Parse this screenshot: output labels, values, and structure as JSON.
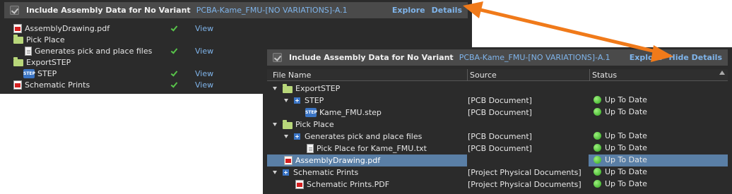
{
  "panel1": {
    "title": "Include Assembly Data for No Variant",
    "subtitle": "PCBA-Kame_FMU-[NO VARIATIONS]-A.1",
    "explore": "Explore",
    "details": "Details",
    "rows": [
      {
        "name": "AssemblyDrawing.pdf",
        "view": "View"
      },
      {
        "name": "Pick Place"
      },
      {
        "name": "Generates pick and place files",
        "view": "View"
      },
      {
        "name": "ExportSTEP"
      },
      {
        "name": "STEP",
        "view": "View"
      },
      {
        "name": "Schematic Prints",
        "view": "View"
      }
    ]
  },
  "panel2": {
    "title": "Include Assembly Data for No Variant",
    "subtitle": "PCBA-Kame_FMU-[NO VARIATIONS]-A.1",
    "explore": "Explore",
    "hide_details": "Hide Details",
    "columns": {
      "file": "File Name",
      "source": "Source",
      "status": "Status"
    },
    "rows": [
      {
        "name": "ExportSTEP",
        "source": "",
        "status": ""
      },
      {
        "name": "STEP",
        "source": "[PCB Document]",
        "status": "Up To Date"
      },
      {
        "name": "Kame_FMU.step",
        "source": "[PCB Document]",
        "status": "Up To Date"
      },
      {
        "name": "Pick Place",
        "source": "",
        "status": ""
      },
      {
        "name": "Generates pick and place files",
        "source": "[PCB Document]",
        "status": "Up To Date"
      },
      {
        "name": "Pick Place for Kame_FMU.txt",
        "source": "[PCB Document]",
        "status": "Up To Date"
      },
      {
        "name": "AssemblyDrawing.pdf",
        "source": "",
        "status": "Up To Date"
      },
      {
        "name": "Schematic Prints",
        "source": "[Project Physical Documents]",
        "status": "Up To Date"
      },
      {
        "name": "Schematic Prints.PDF",
        "source": "[Project Physical Documents]",
        "status": "Up To Date"
      }
    ]
  },
  "colors": {
    "accent": "#7fb4ea",
    "arrow": "#f07a1a",
    "ok": "#58c44a",
    "selected": "#5a7fa6"
  }
}
